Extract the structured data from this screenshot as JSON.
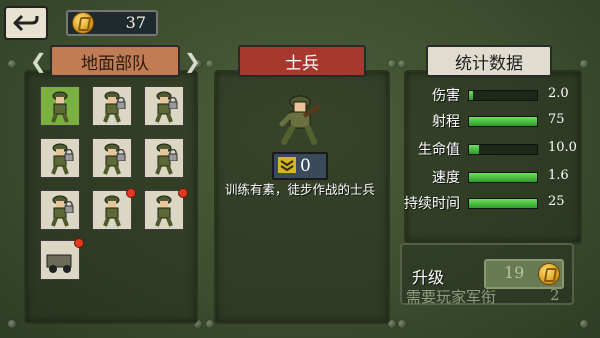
{
  "header": {
    "back_icon": "back-arrow-icon",
    "coin_icon": "gold-coin-icon",
    "coins": "37"
  },
  "tabs": {
    "ground_troops": "地面部队",
    "unit_name": "士兵",
    "statistics": "统计数据"
  },
  "units": [
    {
      "name": "soldier",
      "selected": true,
      "locked": false,
      "new": false
    },
    {
      "name": "bazooka-trooper",
      "selected": false,
      "locked": true,
      "new": false
    },
    {
      "name": "machine-gunner",
      "selected": false,
      "locked": true,
      "new": false
    },
    {
      "name": "grenadier",
      "selected": false,
      "locked": true,
      "new": false
    },
    {
      "name": "flamethrower",
      "selected": false,
      "locked": true,
      "new": false
    },
    {
      "name": "heavy-gunner",
      "selected": false,
      "locked": true,
      "new": false
    },
    {
      "name": "officer",
      "selected": false,
      "locked": true,
      "new": false
    },
    {
      "name": "rifleman",
      "selected": false,
      "locked": false,
      "new": true
    },
    {
      "name": "sniper",
      "selected": false,
      "locked": false,
      "new": true
    },
    {
      "name": "armored-car",
      "selected": false,
      "locked": false,
      "new": true
    }
  ],
  "unit_detail": {
    "rank_icon": "rank-chevron-icon",
    "rank": "0",
    "description": "训练有素，徒步作战的士兵"
  },
  "stats": [
    {
      "label": "伤害",
      "value": "2.0",
      "fill": 0.06
    },
    {
      "label": "射程",
      "value": "75",
      "fill": 1.0
    },
    {
      "label": "生命值",
      "value": "10.0",
      "fill": 0.14
    },
    {
      "label": "速度",
      "value": "1.6",
      "fill": 1.0
    },
    {
      "label": "持续时间",
      "value": "25",
      "fill": 1.0
    }
  ],
  "upgrade": {
    "title": "升级",
    "cost": "19",
    "requirement": "需要玩家军衔",
    "required_rank": "2"
  }
}
